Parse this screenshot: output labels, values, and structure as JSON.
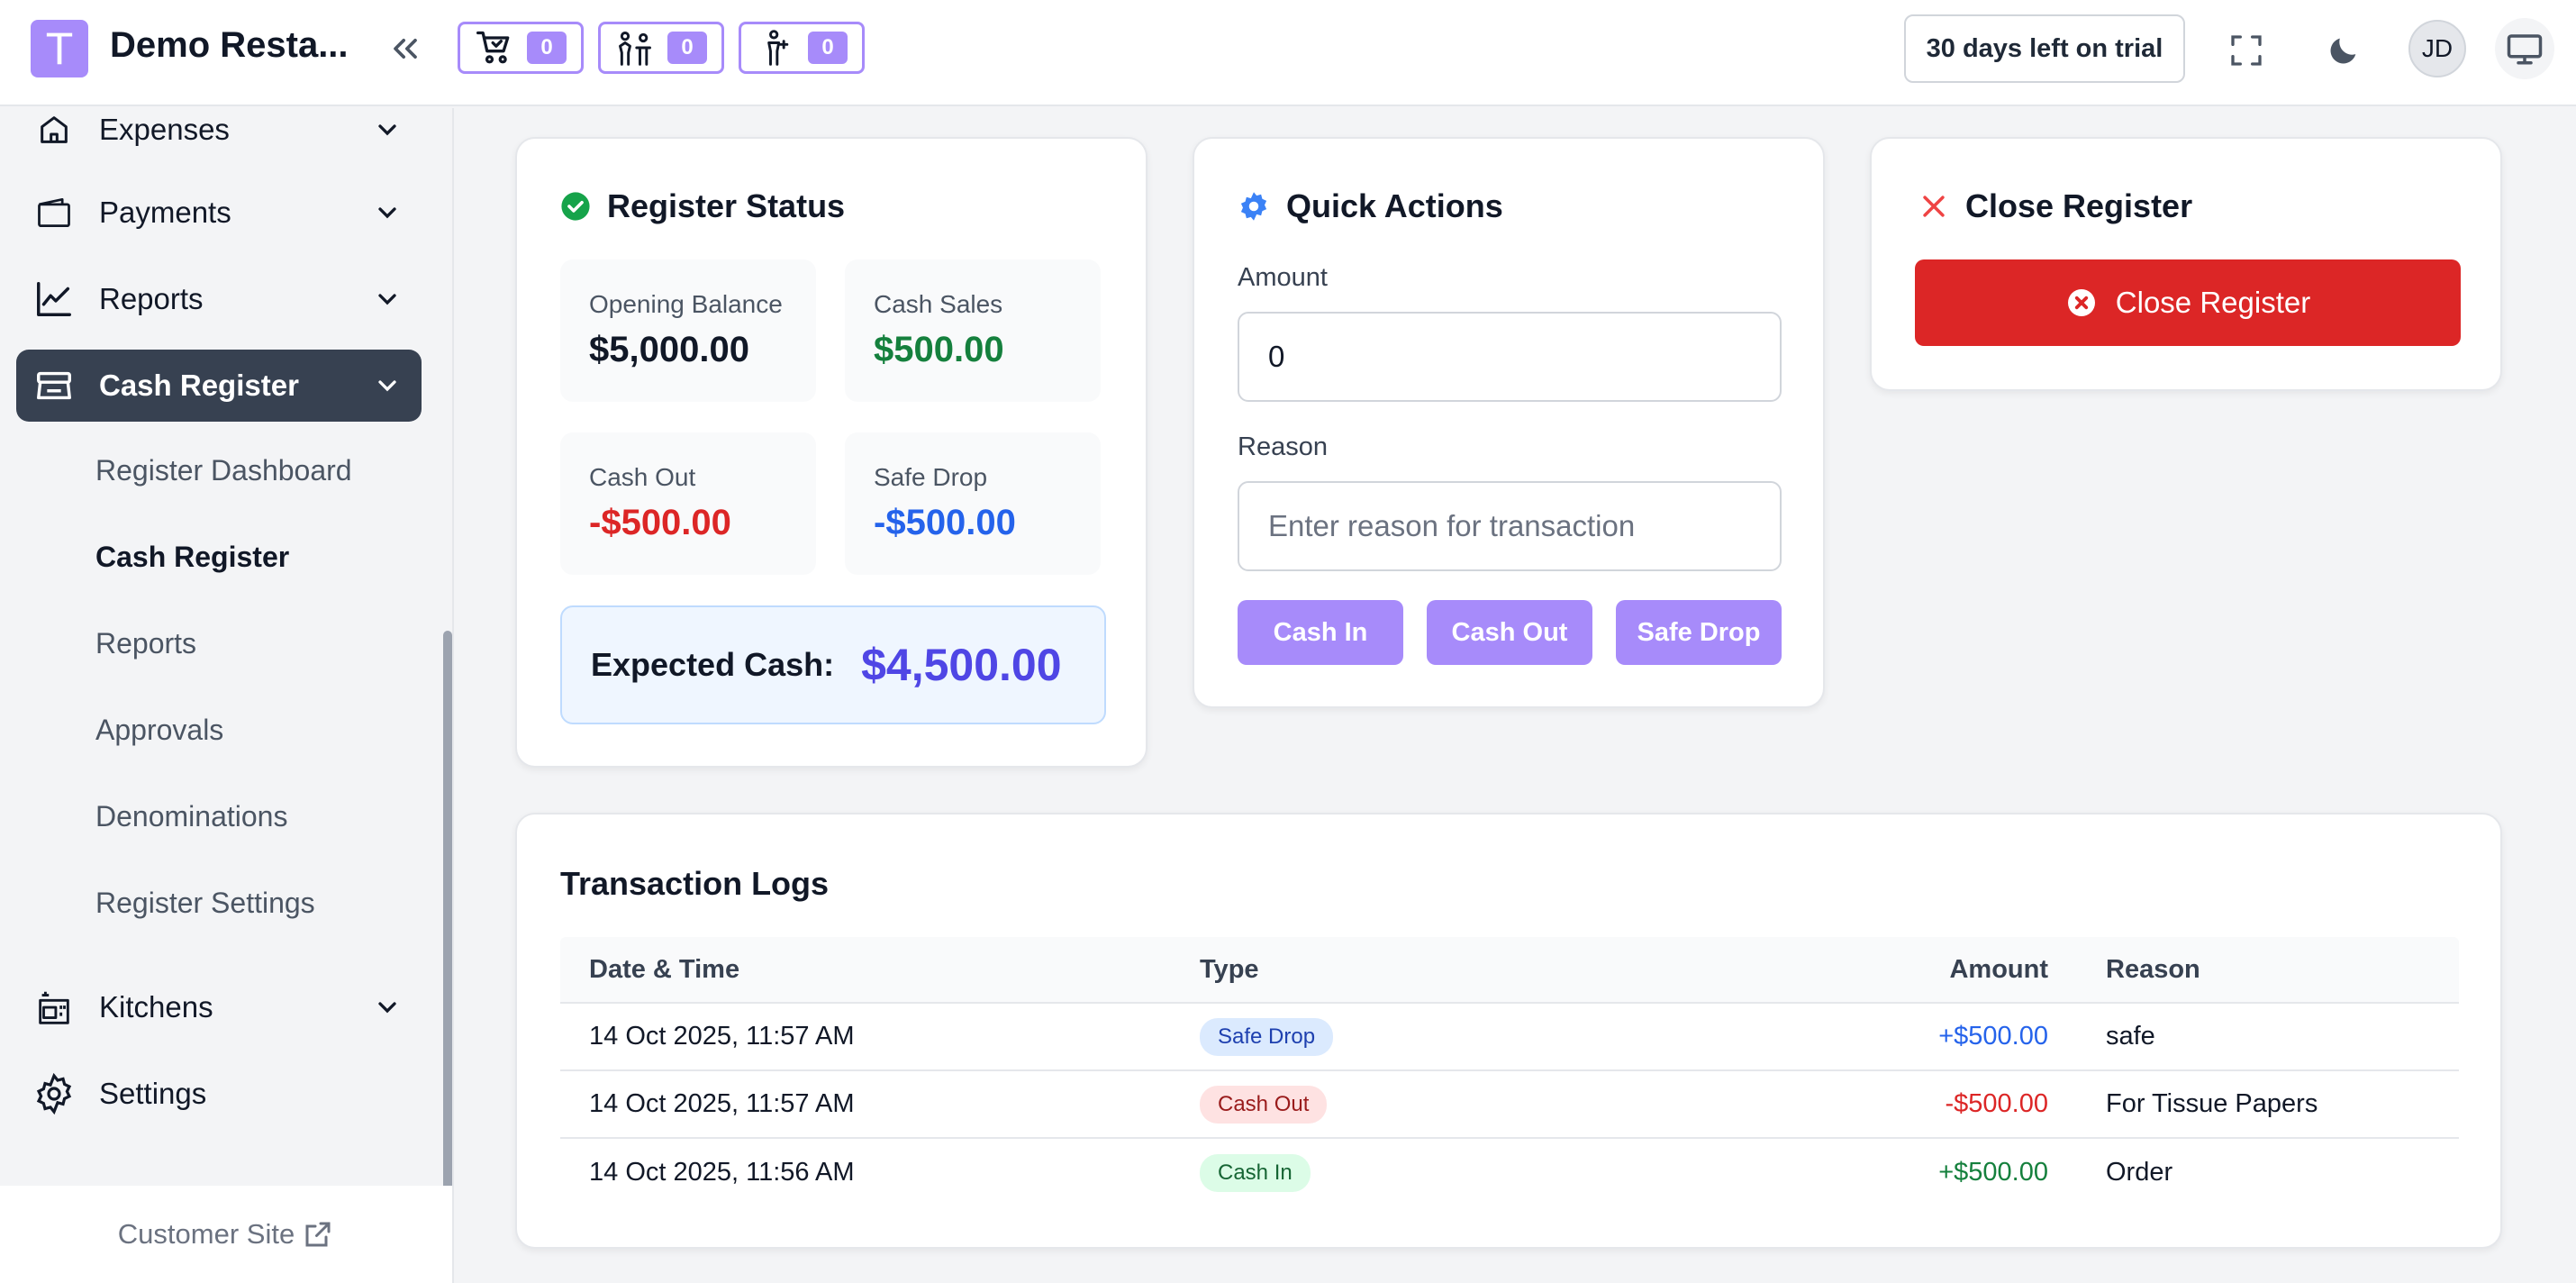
{
  "header": {
    "logo_letter": "T",
    "brand": "Demo Resta...",
    "order_chips": [
      {
        "icon": "cart-icon",
        "count": "0"
      },
      {
        "icon": "dine-in-icon",
        "count": "0"
      },
      {
        "icon": "waiter-icon",
        "count": "0"
      }
    ],
    "trial_label": "30 days left on trial",
    "avatar_initials": "JD"
  },
  "sidebar": {
    "items": [
      {
        "label": "Expenses",
        "icon": "home-icon"
      },
      {
        "label": "Payments",
        "icon": "wallet-icon"
      },
      {
        "label": "Reports",
        "icon": "chart-line-icon"
      },
      {
        "label": "Cash Register",
        "icon": "cash-register-icon",
        "active": true
      },
      {
        "label": "Kitchens",
        "icon": "kitchen-icon"
      },
      {
        "label": "Settings",
        "icon": "gear-icon"
      }
    ],
    "sub_items": [
      "Register Dashboard",
      "Cash Register",
      "Reports",
      "Approvals",
      "Denominations",
      "Register Settings"
    ],
    "current_sub": "Cash Register",
    "footer_link": "Customer Site"
  },
  "register_status": {
    "title": "Register Status",
    "opening_label": "Opening Balance",
    "opening_value": "$5,000.00",
    "cash_sales_label": "Cash Sales",
    "cash_sales_value": "$500.00",
    "cash_out_label": "Cash Out",
    "cash_out_value": "-$500.00",
    "safe_drop_label": "Safe Drop",
    "safe_drop_value": "-$500.00",
    "expected_label": "Expected Cash:",
    "expected_value": "$4,500.00"
  },
  "quick_actions": {
    "title": "Quick Actions",
    "amount_label": "Amount",
    "amount_value": "0",
    "reason_label": "Reason",
    "reason_placeholder": "Enter reason for transaction",
    "buttons": [
      "Cash In",
      "Cash Out",
      "Safe Drop"
    ]
  },
  "close_register": {
    "title": "Close Register",
    "button_label": "Close Register"
  },
  "transaction_logs": {
    "title": "Transaction Logs",
    "columns": [
      "Date & Time",
      "Type",
      "Amount",
      "Reason"
    ],
    "rows": [
      {
        "date": "14 Oct 2025, 11:57 AM",
        "type": "Safe Drop",
        "amount": "+$500.00",
        "reason": "safe"
      },
      {
        "date": "14 Oct 2025, 11:57 AM",
        "type": "Cash Out",
        "amount": "-$500.00",
        "reason": "For Tissue Papers"
      },
      {
        "date": "14 Oct 2025, 11:56 AM",
        "type": "Cash In",
        "amount": "+$500.00",
        "reason": "Order"
      }
    ]
  },
  "colors": {
    "accent": "#a78bfa",
    "positive": "#15803d",
    "negative": "#dc2626",
    "safe_drop": "#2563eb",
    "expected": "#4f46e5"
  }
}
